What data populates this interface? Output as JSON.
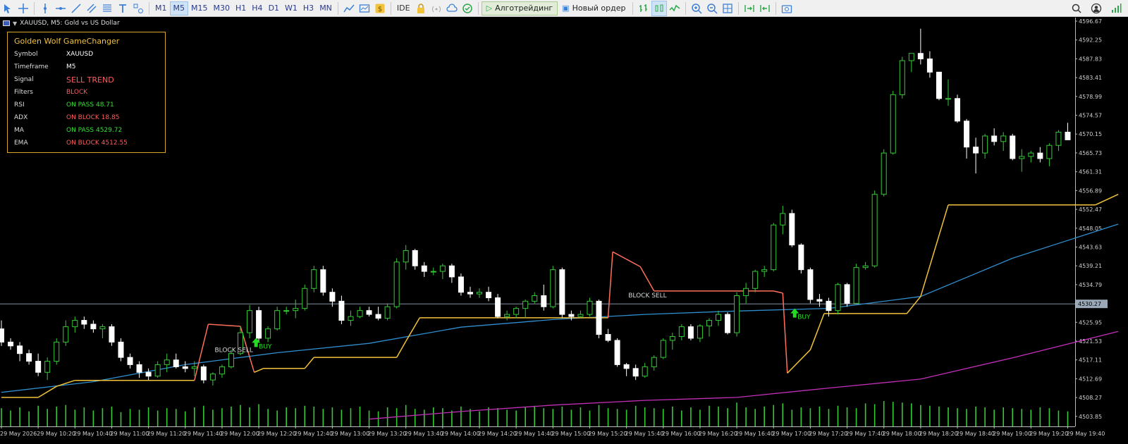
{
  "toolbar": {
    "timeframes": [
      "M1",
      "M5",
      "M15",
      "M30",
      "H1",
      "H4",
      "D1",
      "W1",
      "H3",
      "MN"
    ],
    "active_timeframe": "M5",
    "ide_label": "IDE",
    "algo_label": "Алготрейдинг",
    "new_order_label": "Новый ордер",
    "left_icons": [
      "cursor-icon",
      "crosshair-icon",
      "vertical-line-icon",
      "horizontal-line-icon",
      "trendline-icon",
      "channel-icon",
      "fibonacci-icon",
      "text-icon",
      "shapes-icon"
    ],
    "right_icons": [
      "search-icon",
      "account-icon",
      "signal-strength-icon"
    ]
  },
  "chart": {
    "title": "XAUUSD, M5:  Gold vs US Dollar",
    "current_price": "4530.27",
    "price_labels": [
      "4596.67",
      "4592.25",
      "4587.83",
      "4583.41",
      "4578.99",
      "4574.57",
      "4570.15",
      "4565.73",
      "4561.31",
      "4556.89",
      "4552.47",
      "4548.05",
      "4543.63",
      "4539.21",
      "4534.79",
      "4530.37",
      "4525.95",
      "4521.53",
      "4517.11",
      "4512.69",
      "4508.27",
      "4503.85"
    ],
    "time_labels": [
      "29 May 2026",
      "29 May 10:20",
      "29 May 10:40",
      "29 May 11:00",
      "29 May 11:20",
      "29 May 11:40",
      "29 May 12:00",
      "29 May 12:20",
      "29 May 12:40",
      "29 May 13:00",
      "29 May 13:20",
      "29 May 13:40",
      "29 May 14:00",
      "29 May 14:20",
      "29 May 14:40",
      "29 May 15:00",
      "29 May 15:20",
      "29 May 15:40",
      "29 May 16:00",
      "29 May 16:20",
      "29 May 16:40",
      "29 May 17:00",
      "29 May 17:20",
      "29 May 17:40",
      "29 May 18:00",
      "29 May 18:20",
      "29 May 18:40",
      "29 May 19:00",
      "29 May 19:20",
      "29 May 19:40"
    ],
    "annotations": {
      "block_sell_1": "BLOCK SELL",
      "block_sell_2": "BLOCK SELL",
      "buy_1": "BUY",
      "buy_2": "BUY"
    },
    "colors": {
      "bull": "#35c935",
      "bear": "#ffffff",
      "supertrend_up": "#f2c33a",
      "supertrend_down": "#ff6f5c",
      "ma_blue": "#2f8ecf",
      "ema_magenta": "#c22fb8",
      "volume": "#35c935",
      "price_line": "#9aa8b8"
    }
  },
  "panel": {
    "title": "Golden Wolf GameChanger",
    "rows": [
      {
        "key": "Symbol",
        "value": "XAUUSD"
      },
      {
        "key": "Timeframe",
        "value": "M5"
      },
      {
        "key": "Signal",
        "value": "SELL TREND"
      },
      {
        "key": "Filters",
        "value": "BLOCK"
      },
      {
        "key": "RSI",
        "value": "ON PASS 48.71"
      },
      {
        "key": "ADX",
        "value": "ON BLOCK 18.85"
      },
      {
        "key": "MA",
        "value": "ON PASS 4529.72"
      },
      {
        "key": "EMA",
        "value": "ON BLOCK 4512.55"
      }
    ]
  },
  "chart_data": {
    "type": "candlestick",
    "symbol": "XAUUSD",
    "timeframe": "M5",
    "candles": [
      [
        4524.4,
        4526.4,
        4520.4,
        4521.3
      ],
      [
        4521.3,
        4522.2,
        4519.5,
        4520.4
      ],
      [
        4520.4,
        4521.3,
        4516.8,
        4518.6
      ],
      [
        4518.6,
        4519.5,
        4516.0,
        4516.8
      ],
      [
        4516.8,
        4518.6,
        4513.3,
        4514.2
      ],
      [
        4514.2,
        4517.7,
        4512.4,
        4516.8
      ],
      [
        4516.8,
        4522.2,
        4516.0,
        4521.3
      ],
      [
        4521.3,
        4526.4,
        4520.4,
        4524.9
      ],
      [
        4524.9,
        4527.3,
        4523.5,
        4526.4
      ],
      [
        4526.4,
        4527.3,
        4524.4,
        4525.5
      ],
      [
        4525.5,
        4526.4,
        4523.5,
        4524.4
      ],
      [
        4524.4,
        4525.5,
        4522.2,
        4524.9
      ],
      [
        4524.9,
        4525.5,
        4520.4,
        4521.3
      ],
      [
        4521.3,
        4522.2,
        4516.8,
        4517.7
      ],
      [
        4517.7,
        4518.6,
        4515.1,
        4516.0
      ],
      [
        4516.0,
        4516.8,
        4512.9,
        4514.2
      ],
      [
        4514.2,
        4515.1,
        4512.4,
        4513.3
      ],
      [
        4513.3,
        4516.8,
        4512.9,
        4516.0
      ],
      [
        4516.0,
        4518.6,
        4514.2,
        4517.1
      ],
      [
        4517.1,
        4518.6,
        4515.1,
        4515.5
      ],
      [
        4515.5,
        4516.8,
        4514.2,
        4515.1
      ],
      [
        4515.1,
        4516.8,
        4513.3,
        4515.5
      ],
      [
        4515.5,
        4516.0,
        4511.6,
        4512.4
      ],
      [
        4512.4,
        4514.2,
        4511.1,
        4513.8
      ],
      [
        4513.8,
        4516.0,
        4512.9,
        4515.5
      ],
      [
        4515.5,
        4519.5,
        4515.1,
        4518.6
      ],
      [
        4518.6,
        4525.0,
        4518.2,
        4523.5
      ],
      [
        4523.5,
        4530.0,
        4522.2,
        4528.7
      ],
      [
        4528.7,
        4529.6,
        4521.3,
        4522.2
      ],
      [
        4522.2,
        4525.0,
        4521.3,
        4524.4
      ],
      [
        4524.4,
        4529.6,
        4524.0,
        4528.7
      ],
      [
        4528.7,
        4529.6,
        4527.8,
        4528.7
      ],
      [
        4528.7,
        4531.3,
        4526.9,
        4529.2
      ],
      [
        4529.2,
        4534.8,
        4528.7,
        4533.9
      ],
      [
        4533.9,
        4539.2,
        4533.0,
        4538.3
      ],
      [
        4538.3,
        4539.2,
        4532.2,
        4533.0
      ],
      [
        4533.0,
        4533.9,
        4529.6,
        4530.9
      ],
      [
        4530.9,
        4532.2,
        4525.5,
        4526.4
      ],
      [
        4526.4,
        4528.7,
        4525.1,
        4527.3
      ],
      [
        4527.3,
        4529.6,
        4526.9,
        4528.7
      ],
      [
        4528.7,
        4529.6,
        4527.3,
        4527.8
      ],
      [
        4527.8,
        4529.6,
        4526.4,
        4526.9
      ],
      [
        4526.9,
        4530.4,
        4526.4,
        4529.6
      ],
      [
        4529.6,
        4541.0,
        4529.2,
        4540.1
      ],
      [
        4540.1,
        4544.1,
        4538.3,
        4542.8
      ],
      [
        4542.8,
        4543.2,
        4538.3,
        4539.2
      ],
      [
        4539.2,
        4540.1,
        4536.6,
        4537.9
      ],
      [
        4537.9,
        4538.8,
        4537.0,
        4537.9
      ],
      [
        4537.9,
        4539.7,
        4536.1,
        4539.2
      ],
      [
        4539.2,
        4539.7,
        4535.2,
        4536.6
      ],
      [
        4536.6,
        4537.4,
        4532.2,
        4533.0
      ],
      [
        4533.0,
        4534.3,
        4531.7,
        4532.6
      ],
      [
        4532.6,
        4533.9,
        4531.7,
        4533.0
      ],
      [
        4533.0,
        4534.3,
        4530.9,
        4531.7
      ],
      [
        4531.7,
        4532.6,
        4526.9,
        4527.3
      ],
      [
        4527.3,
        4528.7,
        4526.4,
        4527.8
      ],
      [
        4527.8,
        4529.6,
        4526.9,
        4529.2
      ],
      [
        4529.2,
        4531.3,
        4526.9,
        4530.9
      ],
      [
        4530.9,
        4533.0,
        4530.4,
        4532.2
      ],
      [
        4532.2,
        4534.8,
        4528.7,
        4529.6
      ],
      [
        4529.6,
        4539.2,
        4529.2,
        4538.3
      ],
      [
        4538.3,
        4538.8,
        4526.9,
        4527.8
      ],
      [
        4527.8,
        4528.7,
        4526.4,
        4527.3
      ],
      [
        4527.3,
        4528.7,
        4526.9,
        4527.8
      ],
      [
        4527.8,
        4531.7,
        4527.3,
        4530.9
      ],
      [
        4530.9,
        4531.3,
        4522.2,
        4523.1
      ],
      [
        4523.1,
        4524.4,
        4521.3,
        4521.7
      ],
      [
        4521.7,
        4522.2,
        4515.5,
        4516.0
      ],
      [
        4516.0,
        4516.4,
        4513.3,
        4515.1
      ],
      [
        4515.1,
        4516.0,
        4512.4,
        4513.3
      ],
      [
        4513.3,
        4516.4,
        4512.9,
        4515.5
      ],
      [
        4515.5,
        4518.2,
        4514.6,
        4517.7
      ],
      [
        4517.7,
        4522.2,
        4517.3,
        4521.7
      ],
      [
        4521.7,
        4523.5,
        4519.5,
        4522.6
      ],
      [
        4522.6,
        4525.5,
        4521.7,
        4524.9
      ],
      [
        4524.9,
        4525.5,
        4521.7,
        4522.2
      ],
      [
        4522.2,
        4525.5,
        4521.3,
        4525.1
      ],
      [
        4525.1,
        4526.9,
        4522.6,
        4526.4
      ],
      [
        4526.4,
        4528.7,
        4525.1,
        4527.8
      ],
      [
        4527.8,
        4528.3,
        4523.1,
        4523.5
      ],
      [
        4523.5,
        4533.0,
        4522.6,
        4532.2
      ],
      [
        4532.2,
        4535.2,
        4530.4,
        4533.9
      ],
      [
        4533.9,
        4538.3,
        4533.0,
        4537.9
      ],
      [
        4537.9,
        4539.2,
        4536.6,
        4538.3
      ],
      [
        4538.3,
        4549.3,
        4537.9,
        4548.8
      ],
      [
        4548.8,
        4553.3,
        4546.6,
        4551.5
      ],
      [
        4551.5,
        4552.4,
        4543.6,
        4544.1
      ],
      [
        4544.1,
        4544.5,
        4537.4,
        4538.3
      ],
      [
        4538.3,
        4538.8,
        4530.4,
        4531.3
      ],
      [
        4531.3,
        4532.6,
        4529.6,
        4530.9
      ],
      [
        4530.9,
        4531.7,
        4527.3,
        4528.7
      ],
      [
        4528.7,
        4535.2,
        4527.8,
        4534.8
      ],
      [
        4534.8,
        4535.2,
        4529.6,
        4530.4
      ],
      [
        4530.4,
        4539.7,
        4530.4,
        4538.8
      ],
      [
        4538.8,
        4540.1,
        4538.3,
        4539.2
      ],
      [
        4539.2,
        4556.9,
        4538.8,
        4556.0
      ],
      [
        4556.0,
        4566.6,
        4555.5,
        4565.7
      ],
      [
        4565.7,
        4580.3,
        4565.3,
        4579.4
      ],
      [
        4579.4,
        4588.3,
        4578.5,
        4587.4
      ],
      [
        4587.4,
        4589.1,
        4584.7,
        4589.1
      ],
      [
        4589.1,
        4594.9,
        4586.5,
        4587.8
      ],
      [
        4587.8,
        4589.6,
        4583.4,
        4584.7
      ],
      [
        4584.7,
        4584.7,
        4578.1,
        4578.5
      ],
      [
        4578.5,
        4583.0,
        4576.8,
        4578.5
      ],
      [
        4578.5,
        4579.4,
        4572.8,
        4573.2
      ],
      [
        4573.2,
        4573.7,
        4564.4,
        4567.1
      ],
      [
        4567.1,
        4569.3,
        4560.9,
        4565.7
      ],
      [
        4565.7,
        4570.2,
        4564.4,
        4569.7
      ],
      [
        4569.7,
        4571.5,
        4567.5,
        4568.4
      ],
      [
        4568.4,
        4570.6,
        4566.2,
        4569.7
      ],
      [
        4569.7,
        4570.2,
        4564.0,
        4564.4
      ],
      [
        4564.4,
        4566.6,
        4561.3,
        4564.9
      ],
      [
        4564.9,
        4566.2,
        4563.5,
        4565.7
      ],
      [
        4565.7,
        4567.1,
        4563.5,
        4564.4
      ],
      [
        4564.4,
        4568.0,
        4562.6,
        4567.5
      ],
      [
        4567.5,
        4571.1,
        4566.2,
        4570.6
      ],
      [
        4570.6,
        4572.8,
        4568.8,
        4568.8
      ]
    ],
    "volume": [
      23,
      20,
      24,
      19,
      26,
      22,
      25,
      27,
      21,
      24,
      20,
      23,
      25,
      18,
      22,
      21,
      24,
      20,
      23,
      22,
      19,
      24,
      26,
      21,
      23,
      25,
      27,
      24,
      28,
      22,
      20,
      24,
      23,
      26,
      25,
      22,
      24,
      21,
      23,
      25,
      20,
      19,
      24,
      23,
      27,
      22,
      21,
      24,
      23,
      20,
      25,
      22,
      19,
      24,
      23,
      21,
      20,
      24,
      26,
      23,
      22,
      25,
      21,
      24,
      20,
      27,
      23,
      22,
      21,
      26,
      24,
      23,
      22,
      25,
      20,
      24,
      21,
      26,
      25,
      23,
      30,
      24,
      22,
      25,
      27,
      29,
      21,
      24,
      23,
      25,
      22,
      26,
      24,
      23,
      29,
      28,
      32,
      31,
      30,
      29,
      27,
      26,
      25,
      24,
      23,
      22,
      25,
      24,
      21,
      24,
      23,
      22,
      21,
      24,
      23,
      20,
      19
    ],
    "supertrend": [
      {
        "x": 0,
        "y": 4508.3
      },
      {
        "x": 4,
        "y": 4508.3
      },
      {
        "x": 6,
        "y": 4510.9
      },
      {
        "x": 8,
        "y": 4512.3
      },
      {
        "x": 21,
        "y": 4512.3
      },
      {
        "x": 22.5,
        "y": 4525.5
      },
      {
        "x": 26,
        "y": 4525.0
      },
      {
        "x": 27.5,
        "y": 4514.2
      },
      {
        "x": 28.5,
        "y": 4515.1
      },
      {
        "x": 33,
        "y": 4515.1
      },
      {
        "x": 34,
        "y": 4517.7
      },
      {
        "x": 43,
        "y": 4517.7
      },
      {
        "x": 44,
        "y": 4521.5
      },
      {
        "x": 45.5,
        "y": 4527.0
      },
      {
        "x": 66,
        "y": 4527.0
      },
      {
        "x": 66.5,
        "y": 4542.5
      },
      {
        "x": 69.5,
        "y": 4539.0
      },
      {
        "x": 71,
        "y": 4533.3
      },
      {
        "x": 84,
        "y": 4533.3
      },
      {
        "x": 85,
        "y": 4532.8
      },
      {
        "x": 85.5,
        "y": 4514.0
      },
      {
        "x": 88,
        "y": 4519.5
      },
      {
        "x": 89.5,
        "y": 4528.0
      },
      {
        "x": 98.5,
        "y": 4528.0
      },
      {
        "x": 100,
        "y": 4532.0
      },
      {
        "x": 103,
        "y": 4553.5
      },
      {
        "x": 119,
        "y": 4553.5
      },
      {
        "x": 121.5,
        "y": 4556.0
      }
    ],
    "ma_blue": [
      {
        "x": 0,
        "y": 4509.5
      },
      {
        "x": 10,
        "y": 4512.0
      },
      {
        "x": 20,
        "y": 4516.0
      },
      {
        "x": 30,
        "y": 4518.8
      },
      {
        "x": 40,
        "y": 4521.0
      },
      {
        "x": 50,
        "y": 4524.8
      },
      {
        "x": 60,
        "y": 4526.6
      },
      {
        "x": 70,
        "y": 4527.8
      },
      {
        "x": 80,
        "y": 4528.6
      },
      {
        "x": 90,
        "y": 4529.2
      },
      {
        "x": 100,
        "y": 4532.0
      },
      {
        "x": 110,
        "y": 4541.0
      },
      {
        "x": 121.5,
        "y": 4549.0
      }
    ],
    "ema_magenta": [
      {
        "x": 40,
        "y": 4503.2
      },
      {
        "x": 50,
        "y": 4505.0
      },
      {
        "x": 60,
        "y": 4506.5
      },
      {
        "x": 70,
        "y": 4507.6
      },
      {
        "x": 80,
        "y": 4508.3
      },
      {
        "x": 90,
        "y": 4510.5
      },
      {
        "x": 100,
        "y": 4512.6
      },
      {
        "x": 110,
        "y": 4517.6
      },
      {
        "x": 121.5,
        "y": 4523.8
      }
    ],
    "y_range": [
      4501.5,
      4597.5
    ],
    "current_price": 4530.27
  }
}
